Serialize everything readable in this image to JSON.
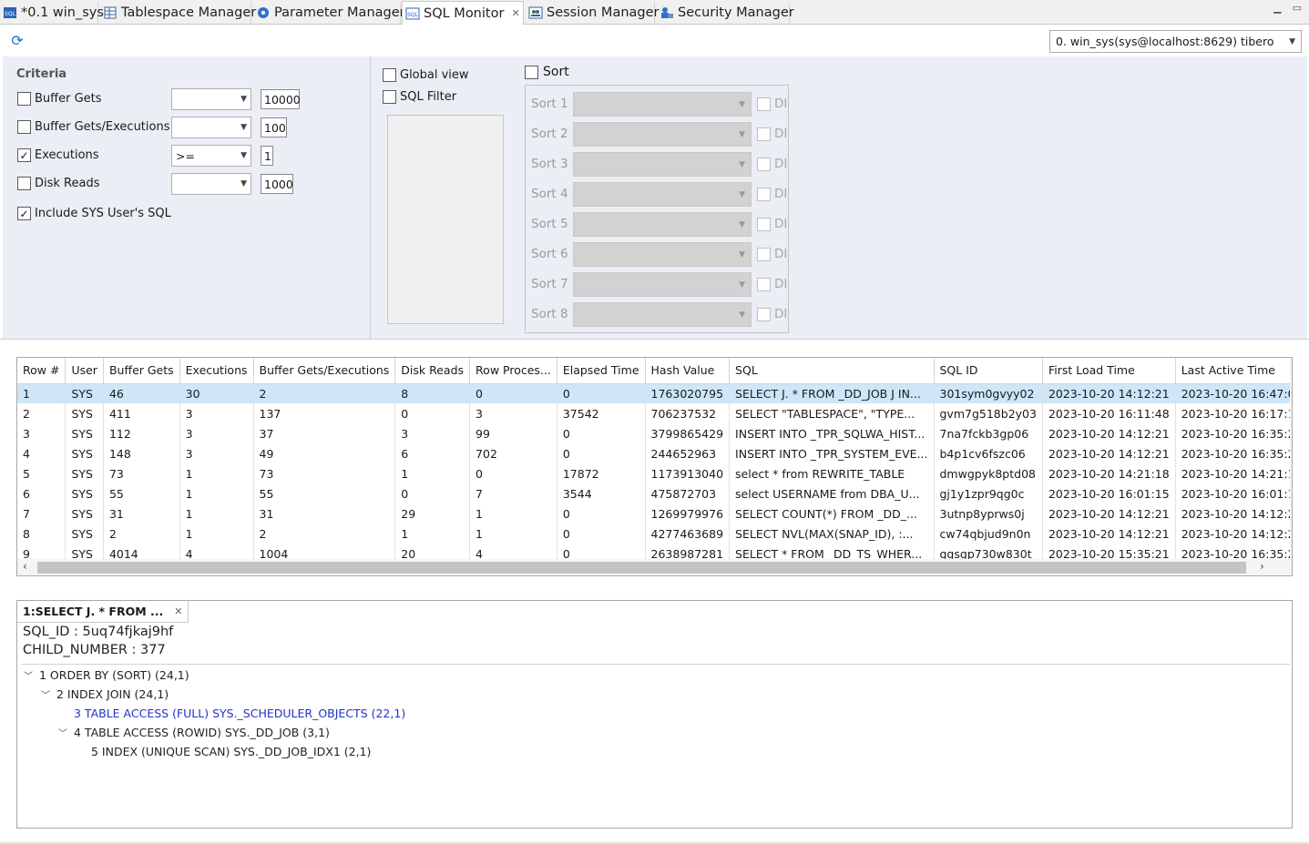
{
  "tabs": [
    {
      "label": "*0.1 win_sys",
      "icon": "sql-editor-icon"
    },
    {
      "label": "Tablespace Manager",
      "icon": "tablespace-icon"
    },
    {
      "label": "Parameter Manager",
      "icon": "gear-icon"
    },
    {
      "label": "SQL Monitor",
      "icon": "sql-monitor-icon",
      "close": "✕"
    },
    {
      "label": "Session Manager",
      "icon": "session-icon"
    },
    {
      "label": "Security Manager",
      "icon": "security-icon"
    }
  ],
  "toolbar": {
    "connection": "0. win_sys(sys@localhost:8629) tibero"
  },
  "criteria": {
    "title": "Criteria",
    "buffer_gets": {
      "label": "Buffer Gets",
      "op": "",
      "value": "10000",
      "checked": false
    },
    "buffer_gets_exec": {
      "label": "Buffer Gets/Executions",
      "op": "",
      "value": "100",
      "checked": false
    },
    "executions": {
      "label": "Executions",
      "op": ">=",
      "value": "1",
      "checked": true
    },
    "disk_reads": {
      "label": "Disk Reads",
      "op": "",
      "value": "1000",
      "checked": false
    },
    "include_sys": {
      "label": "Include SYS User's SQL",
      "checked": true
    }
  },
  "options": {
    "global_view": "Global view",
    "sql_filter": "SQL Filter",
    "sort": "Sort"
  },
  "sorts": [
    "Sort 1",
    "Sort 2",
    "Sort 3",
    "Sort 4",
    "Sort 5",
    "Sort 6",
    "Sort 7",
    "Sort 8"
  ],
  "sort_desc_label": "DI",
  "grid": {
    "columns": [
      "Row #",
      "User",
      "Buffer Gets",
      "Executions",
      "Buffer Gets/Executions",
      "Disk Reads",
      "Row Proces...",
      "Elapsed Time",
      "Hash Value",
      "SQL",
      "SQL ID",
      "First Load Time",
      "Last Active Time"
    ],
    "rows": [
      [
        "1",
        "SYS",
        "46",
        "30",
        "2",
        "8",
        "0",
        "0",
        "1763020795",
        "SELECT J. *   FROM _DD_JOB J IN...",
        "301sym0gvyy02",
        "2023-10-20 14:12:21",
        "2023-10-20 16:47:0"
      ],
      [
        "2",
        "SYS",
        "411",
        "3",
        "137",
        "0",
        "3",
        "37542",
        "706237532",
        "SELECT \"TABLESPACE\",      \"TYPE...",
        "gvm7g518b2y03",
        "2023-10-20 16:11:48",
        "2023-10-20 16:17:1"
      ],
      [
        "3",
        "SYS",
        "112",
        "3",
        "37",
        "3",
        "99",
        "0",
        "3799865429",
        "INSERT INTO _TPR_SQLWA_HIST...",
        "7na7fckb3gp06",
        "2023-10-20 14:12:21",
        "2023-10-20 16:35:2"
      ],
      [
        "4",
        "SYS",
        "148",
        "3",
        "49",
        "6",
        "702",
        "0",
        "244652963",
        "INSERT INTO _TPR_SYSTEM_EVE...",
        "b4p1cv6fszc06",
        "2023-10-20 14:12:21",
        "2023-10-20 16:35:2"
      ],
      [
        "5",
        "SYS",
        "73",
        "1",
        "73",
        "1",
        "0",
        "17872",
        "1173913040",
        "select *   from REWRITE_TABLE",
        "dmwgpyk8ptd08",
        "2023-10-20 14:21:18",
        "2023-10-20 14:21:1"
      ],
      [
        "6",
        "SYS",
        "55",
        "1",
        "55",
        "0",
        "7",
        "3544",
        "475872703",
        "select USERNAME   from DBA_U...",
        "gj1y1zpr9qg0c",
        "2023-10-20 16:01:15",
        "2023-10-20 16:01:1"
      ],
      [
        "7",
        "SYS",
        "31",
        "1",
        "31",
        "29",
        "1",
        "0",
        "1269979976",
        "SELECT COUNT(*)   FROM _DD_...",
        "3utnp8yprws0j",
        "2023-10-20 14:12:21",
        "2023-10-20 14:12:2"
      ],
      [
        "8",
        "SYS",
        "2",
        "1",
        "2",
        "1",
        "1",
        "0",
        "4277463689",
        "SELECT NVL(MAX(SNAP_ID),       :...",
        "cw74qbjud9n0n",
        "2023-10-20 14:12:21",
        "2023-10-20 14:12:2"
      ],
      [
        "9",
        "SYS",
        "4014",
        "4",
        "1004",
        "20",
        "4",
        "0",
        "2638987281",
        "SELECT *   FROM _DD_TS_WHER...",
        "ggsgp730w830t",
        "2023-10-20 15:35:21",
        "2023-10-20 16:35:2"
      ]
    ]
  },
  "plan": {
    "tab_label": "1:SELECT J. *    FROM ...",
    "sql_id": "SQL_ID : 5uq74fjkaj9hf",
    "child_number": "CHILD_NUMBER : 377",
    "nodes": [
      {
        "text": "1 ORDER BY (SORT) (24,1)",
        "level": 0,
        "expanded": true,
        "highlight": false
      },
      {
        "text": "2 INDEX JOIN (24,1)",
        "level": 1,
        "expanded": true,
        "highlight": false
      },
      {
        "text": "3 TABLE ACCESS (FULL) SYS._SCHEDULER_OBJECTS (22,1)",
        "level": 2,
        "expanded": false,
        "highlight": true
      },
      {
        "text": "4 TABLE ACCESS (ROWID) SYS._DD_JOB (3,1)",
        "level": 2,
        "expanded": true,
        "highlight": false
      },
      {
        "text": "5 INDEX (UNIQUE SCAN) SYS._DD_JOB_IDX1 (2,1)",
        "level": 3,
        "expanded": false,
        "highlight": false
      }
    ]
  },
  "colors": {
    "accent": "#1a73c8",
    "selection": "#cde6f8",
    "panel": "#ebeef5",
    "plan_highlight": "#2433c8"
  }
}
